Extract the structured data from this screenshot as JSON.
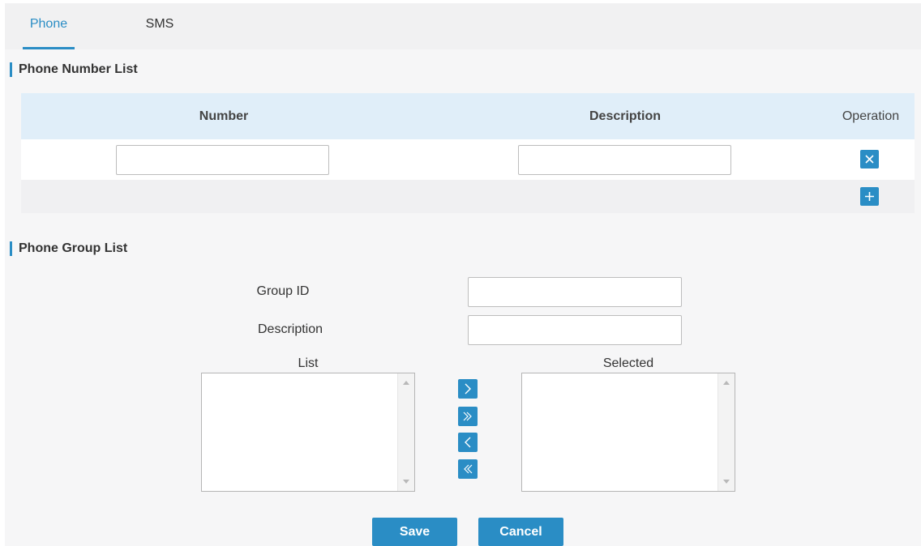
{
  "tabs": [
    {
      "label": "Phone",
      "active": true
    },
    {
      "label": "SMS",
      "active": false
    }
  ],
  "phone_number_list": {
    "title": "Phone Number List",
    "columns": [
      "Number",
      "Description",
      "Operation"
    ],
    "rows": [
      {
        "number": "",
        "description": ""
      }
    ],
    "delete_icon": "close-icon",
    "add_icon": "plus-icon"
  },
  "phone_group_list": {
    "title": "Phone Group List",
    "group_id_label": "Group ID",
    "group_id_value": "",
    "description_label": "Description",
    "description_value": "",
    "list_label": "List",
    "selected_label": "Selected",
    "list_items": [],
    "selected_items": [],
    "move_buttons": [
      "chevron-right-icon",
      "double-chevron-right-icon",
      "chevron-left-icon",
      "double-chevron-left-icon"
    ]
  },
  "buttons": {
    "save": "Save",
    "cancel": "Cancel"
  },
  "colors": {
    "accent": "#2a8dc5",
    "table_header": "#e0eef9",
    "background": "#f6f6f7"
  }
}
